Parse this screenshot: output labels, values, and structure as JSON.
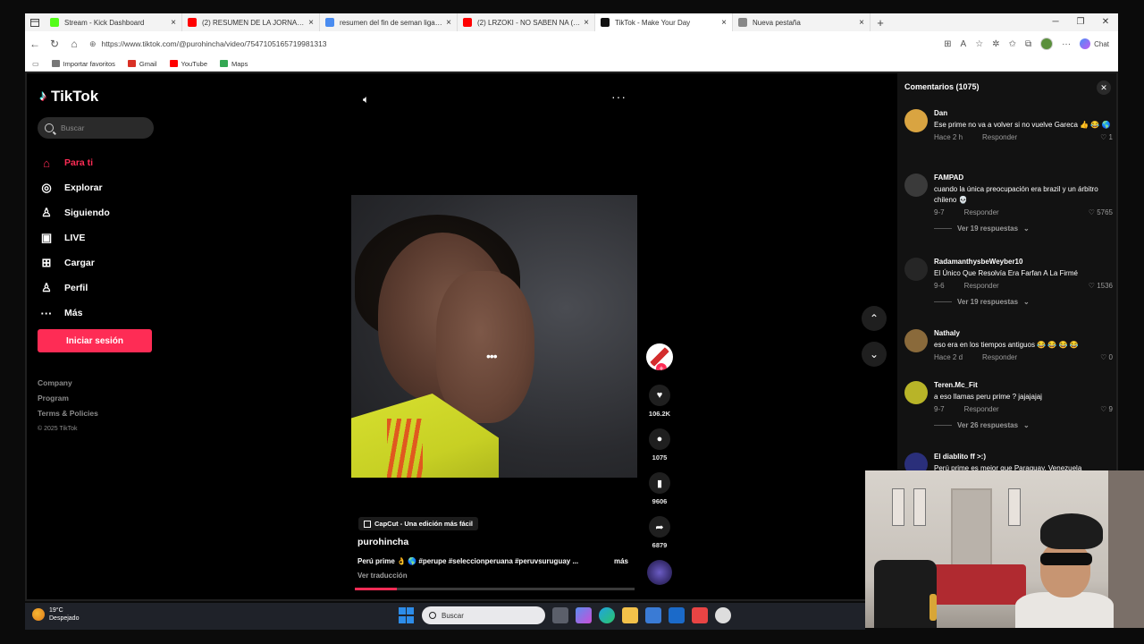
{
  "browser": {
    "tabs": [
      {
        "title": "Stream - Kick Dashboard",
        "fav_color": "#53fc18",
        "active": false
      },
      {
        "title": "(2) RESUMEN DE LA JORNADA 12...",
        "fav_color": "#ff0000",
        "active": false
      },
      {
        "title": "resumen del fin de seman liga ita...",
        "fav_color": "#4a8cf0",
        "active": false
      },
      {
        "title": "(2) LRZOKI - NO SABEN NA (OFIC...",
        "fav_color": "#ff0000",
        "active": false
      },
      {
        "title": "TikTok - Make Your Day",
        "fav_color": "#111111",
        "active": true
      },
      {
        "title": "Nueva pestaña",
        "fav_color": "#888888",
        "active": false
      }
    ],
    "url": "https://www.tiktok.com/@purohincha/video/7547105165719981313",
    "chat_label": "Chat",
    "bookmarks": [
      {
        "label": "Importar favoritos",
        "color": "#777777"
      },
      {
        "label": "Gmail",
        "color": "#d93025"
      },
      {
        "label": "YouTube",
        "color": "#ff0000"
      },
      {
        "label": "Maps",
        "color": "#34a853"
      }
    ]
  },
  "tiktok": {
    "logo": "TikTok",
    "search_placeholder": "Buscar",
    "nav": [
      {
        "label": "Para ti",
        "icon": "home-icon",
        "glyph": "⌂",
        "active": true
      },
      {
        "label": "Explorar",
        "icon": "compass-icon",
        "glyph": "◎",
        "active": false
      },
      {
        "label": "Siguiendo",
        "icon": "following-icon",
        "glyph": "♙",
        "active": false
      },
      {
        "label": "LIVE",
        "icon": "live-icon",
        "glyph": "▣",
        "active": false
      },
      {
        "label": "Cargar",
        "icon": "upload-icon",
        "glyph": "⊞",
        "active": false
      },
      {
        "label": "Perfil",
        "icon": "profile-icon",
        "glyph": "♙",
        "active": false
      },
      {
        "label": "Más",
        "icon": "more-icon",
        "glyph": "···",
        "active": false
      }
    ],
    "login_label": "Iniciar sesión",
    "footer": {
      "company": "Company",
      "program": "Program",
      "terms": "Terms & Policies",
      "copyright": "© 2025 TikTok"
    },
    "video": {
      "capcut_label": "CapCut - Una edición más fácil",
      "author": "purohincha",
      "caption": "Perú prime 👌 🌎 #perupe #seleccionperuana #peruvsuruguay ...",
      "more_label": "más",
      "translate_label": "Ver traducción",
      "progress": 0.15,
      "likes": "106.2K",
      "comments": "1075",
      "saves": "9606",
      "shares": "6879"
    },
    "comments_panel": {
      "title": "Comentarios (1075)",
      "items": [
        {
          "user": "Dan",
          "text": "Ese prime no va a volver si no vuelve Gareca 👍 😂 🌎",
          "time": "Hace 2 h",
          "reply": "Responder",
          "likes": "1",
          "replies": "",
          "avatar": "#d9a441"
        },
        {
          "user": "FAMPAD",
          "text": "cuando la única preocupación era brazil y un árbitro chileno 💀",
          "time": "9-7",
          "reply": "Responder",
          "likes": "5765",
          "replies": "Ver 19 respuestas",
          "avatar": "#3a3a3a"
        },
        {
          "user": "RadamanthysbeWeyber10",
          "text": "El Único Que Resolvía Era Farfan A La Firmé",
          "time": "9-6",
          "reply": "Responder",
          "likes": "1536",
          "replies": "Ver 19 respuestas",
          "avatar": "#262626"
        },
        {
          "user": "Nathaly",
          "text": "eso era en los tiempos antiguos 😂 😂 😂 😂",
          "time": "Hace 2 d",
          "reply": "Responder",
          "likes": "0",
          "replies": "",
          "avatar": "#8a6a3b"
        },
        {
          "user": "Teren.Mc_Fit",
          "text": "a eso llamas peru prime ? jajajajaj",
          "time": "9-7",
          "reply": "Responder",
          "likes": "9",
          "replies": "Ver 26 respuestas",
          "avatar": "#b8b428"
        },
        {
          "user": "El diablito ff >:)",
          "text": "Perú prime es mejor que Paraguay, Venezuela",
          "time": "",
          "reply": "",
          "likes": "",
          "replies": "",
          "avatar": "#2a2f7a"
        }
      ]
    }
  },
  "taskbar": {
    "temperature": "19°C",
    "condition": "Despejado",
    "search_label": "Buscar"
  }
}
